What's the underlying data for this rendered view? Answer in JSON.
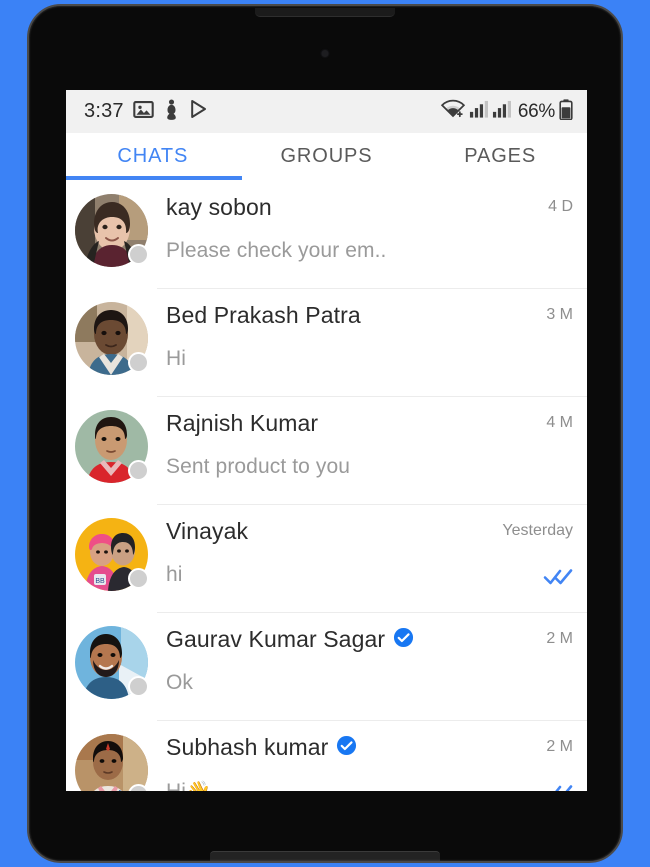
{
  "device": {
    "frame_color": "#0a0a0a",
    "background_color": "#3b82f6"
  },
  "status_bar": {
    "clock": "3:37",
    "battery_percent": "66%",
    "left_icons": [
      "photo-icon",
      "figure-icon",
      "play-store-icon"
    ],
    "right_icons": [
      "wifi-icon",
      "signal-sim1-icon",
      "signal-sim2-icon",
      "battery-icon"
    ]
  },
  "tabs": {
    "items": [
      {
        "label": "CHATS",
        "active": true
      },
      {
        "label": "GROUPS",
        "active": false
      },
      {
        "label": "PAGES",
        "active": false
      }
    ],
    "active_color": "#4285f4",
    "inactive_color": "#5a5a5a"
  },
  "chats": [
    {
      "name": "kay sobon",
      "snippet": "Please check your em..",
      "time": "4 D",
      "verified": false,
      "read_receipt": false,
      "presence": "offline",
      "avatar": "photo-woman-dark-hair"
    },
    {
      "name": "Bed Prakash Patra",
      "snippet": "Hi",
      "time": "3 M",
      "verified": false,
      "read_receipt": false,
      "presence": "offline",
      "avatar": "photo-man-blue-shirt"
    },
    {
      "name": "Rajnish Kumar",
      "snippet": "Sent product to you",
      "time": "4 M",
      "verified": false,
      "read_receipt": false,
      "presence": "offline",
      "avatar": "photo-man-red-shirt"
    },
    {
      "name": "Vinayak",
      "snippet": "hi",
      "time": "Yesterday",
      "verified": false,
      "read_receipt": true,
      "presence": "offline",
      "avatar": "photo-two-kids-yellow-bg"
    },
    {
      "name": "Gaurav Kumar Sagar",
      "snippet": "Ok",
      "time": "2 M",
      "verified": true,
      "read_receipt": false,
      "presence": "offline",
      "avatar": "photo-bearded-man-sky-bg"
    },
    {
      "name": "Subhash kumar",
      "snippet": "Hi",
      "snippet_emoji": "👋",
      "time": "2 M",
      "verified": true,
      "read_receipt": true,
      "presence": "offline",
      "avatar": "photo-boy-outdoors"
    }
  ],
  "colors": {
    "accent": "#4285f4",
    "status_bar_bg": "#f1f1f1",
    "name_text": "#2c2c2c",
    "snippet_text": "#9a9a9a",
    "time_text": "#8e8e8e",
    "presence_offline": "#cfcfcf",
    "divider": "#ececec"
  }
}
